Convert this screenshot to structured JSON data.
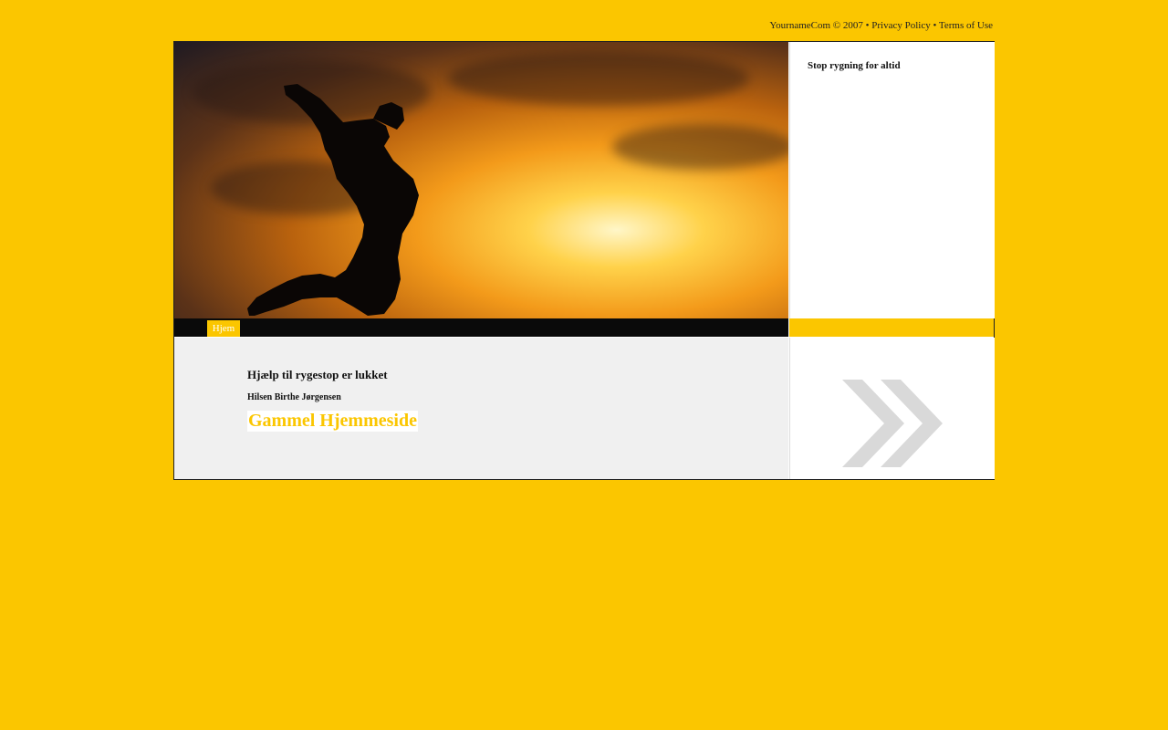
{
  "topbar": {
    "copyright": "YournameCom © 2007",
    "sep1": " • ",
    "privacy": "Privacy Policy",
    "sep2": " • ",
    "terms": "Terms of Use"
  },
  "sidebar": {
    "title": "Stop rygning for altid"
  },
  "nav": {
    "items": [
      {
        "label": "Hjem"
      }
    ]
  },
  "main": {
    "heading": "Hjælp til rygestop er lukket",
    "signature": "Hilsen Birthe Jørgensen",
    "link": "Gammel Hjemmeside"
  },
  "colors": {
    "background": "#fbc600",
    "navbar": "#0a0a0a",
    "content_bg": "#f0f0f0",
    "arrow": "#d9d9d9"
  },
  "icons": {
    "hero": "jumping-silhouette-sunset-image",
    "arrow": "double-chevron-right-icon"
  }
}
